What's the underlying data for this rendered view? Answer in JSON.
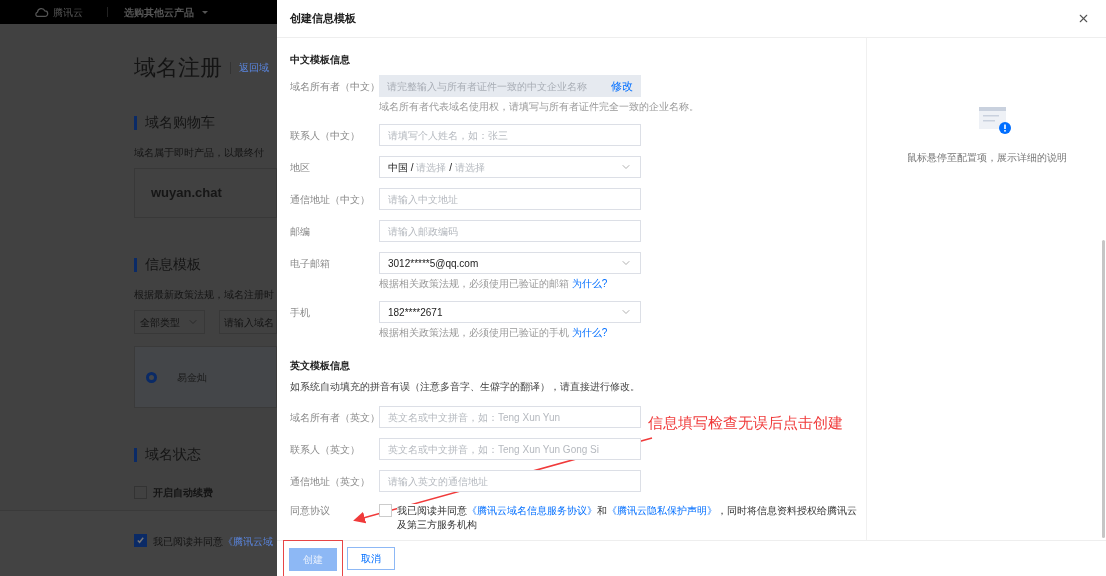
{
  "background_page": {
    "top_bar": {
      "brand": "腾讯云",
      "menu": "选购其他云产品"
    },
    "title": "域名注册",
    "back_link": "返回域",
    "cart": {
      "heading": "域名购物车",
      "note": "域名属于即时产品，以最终付",
      "domain": "wuyan.chat"
    },
    "template": {
      "heading": "信息模板",
      "note": "根据最新政策法规，域名注册时",
      "filter": "全部类型",
      "search_placeholder": "请输入域名",
      "options": [
        {
          "name": "易金灿",
          "selected": true
        }
      ]
    },
    "status": {
      "heading": "域名状态",
      "auto_renew": {
        "label": "开启自动续费",
        "checked": false
      }
    },
    "agree": {
      "checked": true,
      "text": "我已阅读并同意",
      "link": "《腾讯云域"
    }
  },
  "dialog": {
    "title": "创建信息模板",
    "sections": [
      {
        "heading": "中文模板信息",
        "fields": [
          {
            "label": "域名所有者（中文）",
            "kind": "readonly",
            "placeholder": "请完整输入与所有者证件一致的中文企业名称",
            "action": "修改",
            "hint": {
              "text": "域名所有者代表域名使用权，请填写与所有者证件完全一致的企业名称。"
            }
          },
          {
            "label": "联系人（中文）",
            "kind": "input",
            "placeholder": "请填写个人姓名，如：张三"
          },
          {
            "label": "地区",
            "kind": "region",
            "separator": "/",
            "parts": [
              {
                "text": "中国",
                "chosen": true
              },
              {
                "text": "请选择",
                "chosen": false
              },
              {
                "text": "请选择",
                "chosen": false
              }
            ]
          },
          {
            "label": "通信地址（中文）",
            "kind": "input",
            "placeholder": "请输入中文地址"
          },
          {
            "label": "邮编",
            "kind": "input",
            "placeholder": "请输入邮政编码"
          },
          {
            "label": "电子邮箱",
            "kind": "select",
            "value": "3012*****5@qq.com",
            "hint": {
              "text": "根据相关政策法规，必须使用已验证的邮箱 ",
              "link": "为什么?"
            }
          },
          {
            "label": "手机",
            "kind": "select",
            "value": "182****2671",
            "hint": {
              "text": "根据相关政策法规，必须使用已验证的手机 ",
              "link": "为什么?"
            }
          }
        ]
      },
      {
        "heading": "英文模板信息",
        "note": "如系统自动填充的拼音有误（注意多音字、生僻字的翻译），请直接进行修改。",
        "fields": [
          {
            "label": "域名所有者（英文）",
            "kind": "input",
            "placeholder": "英文名或中文拼音，如：Teng Xun Yun"
          },
          {
            "label": "联系人（英文）",
            "kind": "input",
            "placeholder": "英文名或中文拼音，如：Teng Xun Yun Gong Si"
          },
          {
            "label": "通信地址（英文）",
            "kind": "input",
            "placeholder": "请输入英文的通信地址"
          }
        ]
      }
    ],
    "agreement": {
      "label": "同意协议",
      "checked": false,
      "segments": [
        {
          "kind": "text",
          "text": "我已阅读并同意"
        },
        {
          "kind": "link",
          "text": "《腾讯云域名信息服务协议》"
        },
        {
          "kind": "text",
          "text": "和"
        },
        {
          "kind": "link",
          "text": "《腾讯云隐私保护声明》"
        },
        {
          "kind": "text",
          "text": "，同时将信息资料授权给腾讯云及第三方服务机构"
        }
      ]
    },
    "help": "鼠标悬停至配置项，展示详细的说明",
    "buttons": [
      {
        "label": "创建",
        "kind": "primary",
        "disabled": true,
        "highlighted": true
      },
      {
        "label": "取消",
        "kind": "secondary",
        "disabled": false,
        "highlighted": false
      }
    ]
  },
  "annotation": {
    "text": "信息填写检查无误后点击创建"
  }
}
